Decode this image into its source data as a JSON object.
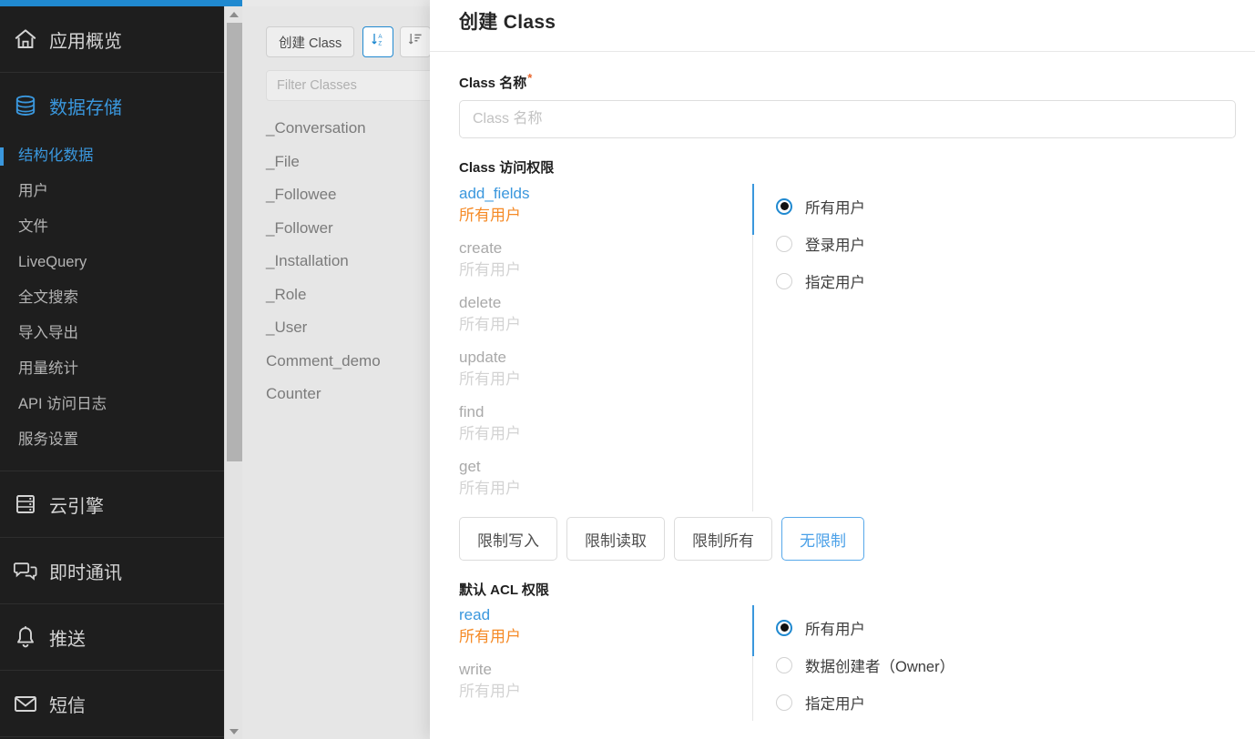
{
  "theme": {
    "accent": "#2089d0",
    "link": "#3a97dd",
    "selected_value": "#f58a26",
    "sidebar_bg": "#1e1e1e",
    "panel_bg": "#e6e6e6",
    "modal_bg": "#ffffff"
  },
  "sidebar": {
    "groups": [
      {
        "icon": "home-icon",
        "label": "应用概览",
        "is_link": false,
        "items": []
      },
      {
        "icon": "database-icon",
        "label": "数据存储",
        "is_link": true,
        "items": [
          {
            "label": "结构化数据",
            "active": true
          },
          {
            "label": "用户",
            "active": false
          },
          {
            "label": "文件",
            "active": false
          },
          {
            "label": "LiveQuery",
            "active": false
          },
          {
            "label": "全文搜索",
            "active": false
          },
          {
            "label": "导入导出",
            "active": false
          },
          {
            "label": "用量统计",
            "active": false
          },
          {
            "label": "API 访问日志",
            "active": false
          },
          {
            "label": "服务设置",
            "active": false
          }
        ]
      },
      {
        "icon": "server-icon",
        "label": "云引擎",
        "is_link": false,
        "items": []
      },
      {
        "icon": "chat-icon",
        "label": "即时通讯",
        "is_link": false,
        "items": []
      },
      {
        "icon": "bell-icon",
        "label": "推送",
        "is_link": false,
        "items": []
      },
      {
        "icon": "envelope-icon",
        "label": "短信",
        "is_link": false,
        "items": []
      }
    ]
  },
  "class_panel": {
    "create_button": "创建 Class",
    "sort_alpha_icon": "sort-alphabetical-icon",
    "sort_list_icon": "sort-descending-icon",
    "filter_placeholder": "Filter Classes",
    "filter_value": "",
    "classes": [
      "_Conversation",
      "_File",
      "_Followee",
      "_Follower",
      "_Installation",
      "_Role",
      "_User",
      "Comment_demo",
      "Counter"
    ]
  },
  "modal": {
    "title": "创建 Class",
    "name_field": {
      "label": "Class 名称",
      "required_mark": "*",
      "placeholder": "Class 名称",
      "value": ""
    },
    "class_permissions": {
      "label": "Class 访问权限",
      "operations": [
        {
          "op": "add_fields",
          "value": "所有用户",
          "selected": true
        },
        {
          "op": "create",
          "value": "所有用户",
          "selected": false
        },
        {
          "op": "delete",
          "value": "所有用户",
          "selected": false
        },
        {
          "op": "update",
          "value": "所有用户",
          "selected": false
        },
        {
          "op": "find",
          "value": "所有用户",
          "selected": false
        },
        {
          "op": "get",
          "value": "所有用户",
          "selected": false
        }
      ],
      "radios": [
        {
          "label": "所有用户",
          "checked": true
        },
        {
          "label": "登录用户",
          "checked": false
        },
        {
          "label": "指定用户",
          "checked": false
        }
      ]
    },
    "presets": [
      {
        "label": "限制写入",
        "active": false
      },
      {
        "label": "限制读取",
        "active": false
      },
      {
        "label": "限制所有",
        "active": false
      },
      {
        "label": "无限制",
        "active": true
      }
    ],
    "acl_permissions": {
      "label": "默认 ACL 权限",
      "operations": [
        {
          "op": "read",
          "value": "所有用户",
          "selected": true
        },
        {
          "op": "write",
          "value": "所有用户",
          "selected": false
        }
      ],
      "radios": [
        {
          "label": "所有用户",
          "checked": true
        },
        {
          "label": "数据创建者（Owner）",
          "checked": false
        },
        {
          "label": "指定用户",
          "checked": false
        }
      ]
    }
  },
  "scrollbar": {
    "up_arrow_icon": "caret-up-icon",
    "down_arrow_icon": "caret-down-icon"
  }
}
